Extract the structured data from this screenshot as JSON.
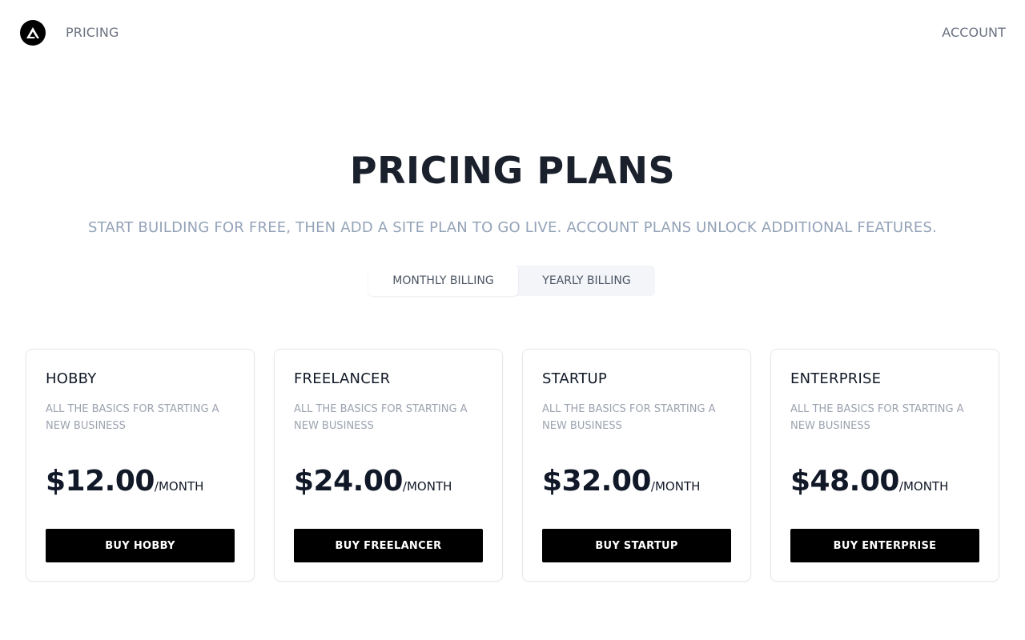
{
  "nav": {
    "logo_icon": "triangle-logo-icon",
    "pricing_label": "PRICING",
    "account_label": "ACCOUNT"
  },
  "hero": {
    "title": "PRICING PLANS",
    "subtitle": "START BUILDING FOR FREE, THEN ADD A SITE PLAN TO GO LIVE. ACCOUNT PLANS UNLOCK ADDITIONAL FEATURES."
  },
  "billing": {
    "monthly_label": "MONTHLY BILLING",
    "yearly_label": "YEARLY BILLING",
    "selected": "monthly"
  },
  "plans": [
    {
      "name": "HOBBY",
      "description": "ALL THE BASICS FOR STARTING A NEW BUSINESS",
      "price": "$12.00",
      "period": "/MONTH",
      "button_label": "BUY HOBBY"
    },
    {
      "name": "FREELANCER",
      "description": "ALL THE BASICS FOR STARTING A NEW BUSINESS",
      "price": "$24.00",
      "period": "/MONTH",
      "button_label": "BUY FREELANCER"
    },
    {
      "name": "STARTUP",
      "description": "ALL THE BASICS FOR STARTING A NEW BUSINESS",
      "price": "$32.00",
      "period": "/MONTH",
      "button_label": "BUY STARTUP"
    },
    {
      "name": "ENTERPRISE",
      "description": "ALL THE BASICS FOR STARTING A NEW BUSINESS",
      "price": "$48.00",
      "period": "/MONTH",
      "button_label": "BUY ENTERPRISE"
    }
  ],
  "colors": {
    "text_dark": "#1a202c",
    "text_muted": "#94a3b8",
    "button_bg": "#000000",
    "toggle_bg": "#f3f5f9"
  }
}
